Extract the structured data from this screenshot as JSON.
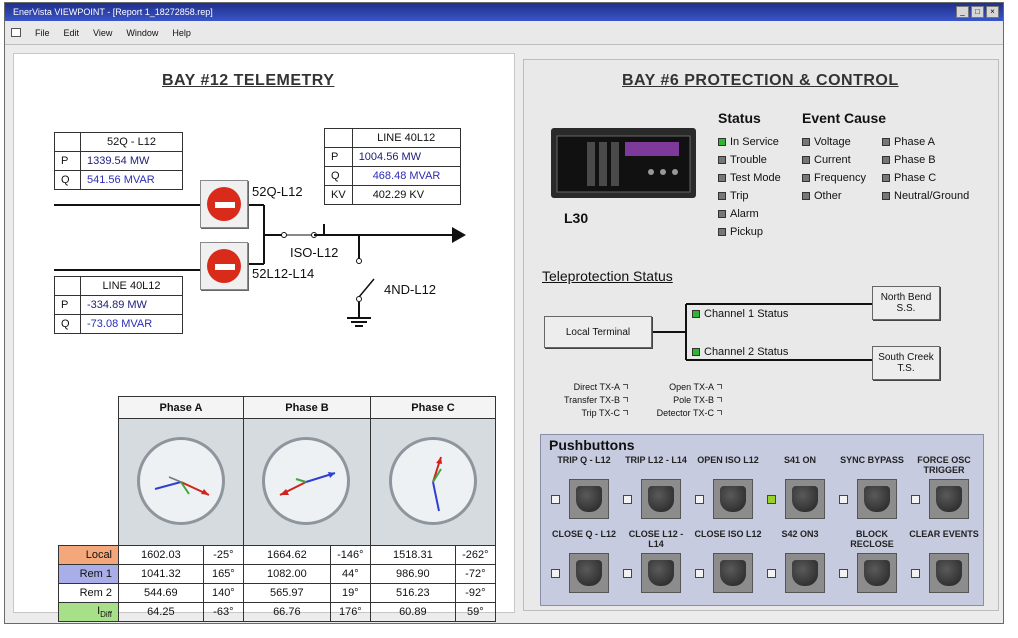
{
  "window": {
    "title": "EnerVista VIEWPOINT - [Report 1_18272858.rep]"
  },
  "menu": [
    "File",
    "Edit",
    "View",
    "Window",
    "Help"
  ],
  "left": {
    "heading": "BAY #12 TELEMETRY",
    "tel_52q": {
      "header": "52Q - L12",
      "p_label": "P",
      "p_value": "1339.54 MW",
      "q_label": "Q",
      "q_value": "541.56 MVAR"
    },
    "tel_line_top": {
      "header": "LINE 40L12",
      "p_label": "P",
      "p_value": "1004.56 MW",
      "q_label": "Q",
      "q_value": "468.48 MVAR",
      "kv_label": "KV",
      "kv_value": "402.29 KV"
    },
    "tel_line_bot": {
      "header": "LINE 40L12",
      "p_label": "P",
      "p_value": "-334.89 MW",
      "q_label": "Q",
      "q_value": "-73.08 MVAR"
    },
    "labels": {
      "brk1": "52Q-L12",
      "brk2": "52L12-L14",
      "iso": "ISO-L12",
      "gnd": "4ND-L12"
    },
    "phase_table": {
      "headers": [
        "Phase A",
        "Phase B",
        "Phase C"
      ],
      "rows": [
        {
          "label": "Local",
          "a": "1602.03",
          "a_ang": "-25°",
          "b": "1664.62",
          "b_ang": "-146°",
          "c": "1518.31",
          "c_ang": "-262°",
          "color": "#f4a77a"
        },
        {
          "label": "Rem 1",
          "a": "1041.32",
          "a_ang": "165°",
          "b": "1082.00",
          "b_ang": "44°",
          "c": "986.90",
          "c_ang": "-72°",
          "color": "#a9aee8"
        },
        {
          "label": "Rem 2",
          "a": "544.69",
          "a_ang": "140°",
          "b": "565.97",
          "b_ang": "19°",
          "c": "516.23",
          "c_ang": "-92°",
          "color": "#ffffff"
        },
        {
          "label": "I",
          "label_sub": "Diff",
          "a": "64.25",
          "a_ang": "-63°",
          "b": "66.76",
          "b_ang": "176°",
          "c": "60.89",
          "c_ang": "59°",
          "color": "#a8e08a"
        }
      ]
    }
  },
  "right": {
    "heading": "BAY #6 PROTECTION & CONTROL",
    "relay_label": "L30",
    "status": {
      "title": "Status",
      "items": [
        {
          "label": "In Service",
          "on": true
        },
        {
          "label": "Trouble",
          "on": false
        },
        {
          "label": "Test Mode",
          "on": false
        },
        {
          "label": "Trip",
          "on": false
        },
        {
          "label": "Alarm",
          "on": false
        },
        {
          "label": "Pickup",
          "on": false
        }
      ]
    },
    "event_cause": {
      "title": "Event Cause",
      "col1": [
        "Voltage",
        "Current",
        "Frequency",
        "Other"
      ],
      "col2": [
        "Phase A",
        "Phase B",
        "Phase C",
        "Neutral/Ground"
      ]
    },
    "teleprotection": {
      "title": "Teleprotection Status",
      "local": "Local Terminal",
      "ch1": "Channel 1 Status",
      "ch2": "Channel 2 Status",
      "remote1": "North Bend S.S.",
      "remote2": "South Creek T.S.",
      "left_flags": [
        "Direct TX-A",
        "Transfer TX-B",
        "Trip TX-C"
      ],
      "right_flags": [
        "Open TX-A",
        "Pole TX-B",
        "Detector TX-C"
      ]
    },
    "pushbuttons": {
      "title": "Pushbuttons",
      "row1": [
        {
          "label": "TRIP Q - L12",
          "led": false
        },
        {
          "label": "TRIP L12 - L14",
          "led": false
        },
        {
          "label": "OPEN ISO L12",
          "led": false
        },
        {
          "label": "S41 ON",
          "led": true
        },
        {
          "label": "SYNC BYPASS",
          "led": false
        },
        {
          "label": "FORCE OSC TRIGGER",
          "led": false
        }
      ],
      "row2": [
        {
          "label": "CLOSE Q - L12",
          "led": false
        },
        {
          "label": "CLOSE L12 - L14",
          "led": false
        },
        {
          "label": "CLOSE ISO L12",
          "led": false
        },
        {
          "label": "S42 ON3",
          "led": false
        },
        {
          "label": "BLOCK RECLOSE",
          "led": false
        },
        {
          "label": "CLEAR EVENTS",
          "led": false
        }
      ]
    }
  }
}
